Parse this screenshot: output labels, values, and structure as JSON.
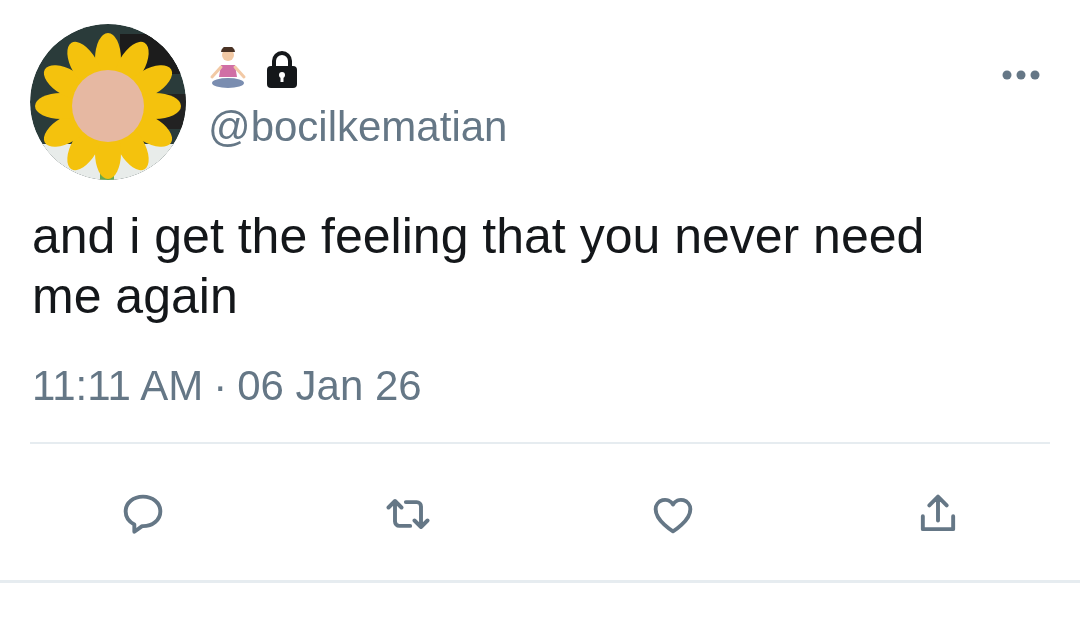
{
  "tweet": {
    "locked": true,
    "handle": "@bocilkematian",
    "text": "and i get the feeling that you never need me again",
    "time": "11:11 AM",
    "separator": "·",
    "date": "06 Jan 26"
  },
  "actions": [
    {
      "kind": "reply"
    },
    {
      "kind": "retweet"
    },
    {
      "kind": "like"
    },
    {
      "kind": "share"
    }
  ]
}
